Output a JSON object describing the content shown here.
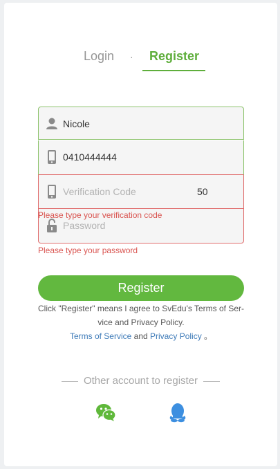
{
  "tabs": {
    "login": "Login",
    "separator": "·",
    "register": "Register"
  },
  "form": {
    "name_value": "Nicole",
    "phone_value": "0410444444",
    "code_placeholder": "Verification Code",
    "countdown": "50",
    "password_placeholder": "Password",
    "code_error": "Please type your verification code",
    "password_error": "Please type your password"
  },
  "register_button": "Register",
  "agreement": {
    "line1": "Click \"Register\" means I agree to SvEdu's Terms of Ser-",
    "line2": "vice and Privacy Policy.",
    "terms_link": "Terms of Service",
    "and": "and",
    "privacy_link": "Privacy Policy",
    "end": "。"
  },
  "other_register": "Other account to register",
  "social": [
    "wechat-icon",
    "qq-icon"
  ],
  "colors": {
    "accent": "#62b83f",
    "error": "#d9534f",
    "link": "#3d7ab8"
  }
}
